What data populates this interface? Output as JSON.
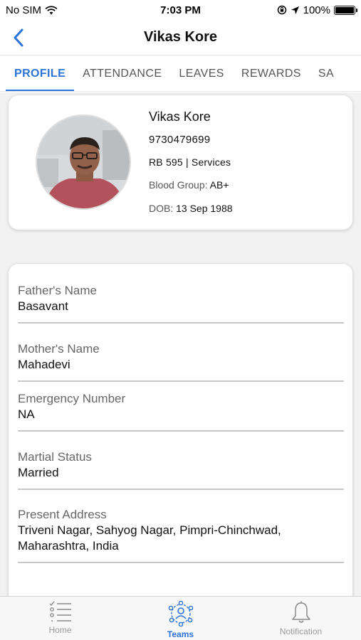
{
  "status_bar": {
    "carrier": "No SIM",
    "time": "7:03 PM",
    "battery": "100%",
    "battery_level": 1.0
  },
  "nav": {
    "title": "Vikas Kore",
    "back_icon": "chevron-left-icon"
  },
  "tabs": [
    {
      "label": "PROFILE",
      "active": true
    },
    {
      "label": "ATTENDANCE",
      "active": false
    },
    {
      "label": "LEAVES",
      "active": false
    },
    {
      "label": "REWARDS",
      "active": false
    },
    {
      "label": "SA",
      "active": false
    }
  ],
  "profile": {
    "name": "Vikas Kore",
    "phone": "9730479699",
    "dept": "RB 595 | Services",
    "blood_group_label": "Blood Group:",
    "blood_group": "AB+",
    "dob_label": "DOB:",
    "dob": "13 Sep 1988"
  },
  "details": [
    {
      "label": "Father's Name",
      "value": "Basavant"
    },
    {
      "label": "Mother's Name",
      "value": "Mahadevi"
    },
    {
      "label": "Emergency Number",
      "value": "NA"
    },
    {
      "label": "Martial Status",
      "value": "Married"
    },
    {
      "label": "Present Address",
      "value": "Triveni Nagar, Sahyog Nagar, Pimpri-Chinchwad, Maharashtra, India"
    }
  ],
  "tab_bar": [
    {
      "label": "Home",
      "icon": "list-icon",
      "active": false
    },
    {
      "label": "Teams",
      "icon": "team-icon",
      "active": true
    },
    {
      "label": "Notification",
      "icon": "bell-icon",
      "active": false
    }
  ],
  "colors": {
    "accent": "#2a73d9",
    "background": "#f2f2f2"
  }
}
